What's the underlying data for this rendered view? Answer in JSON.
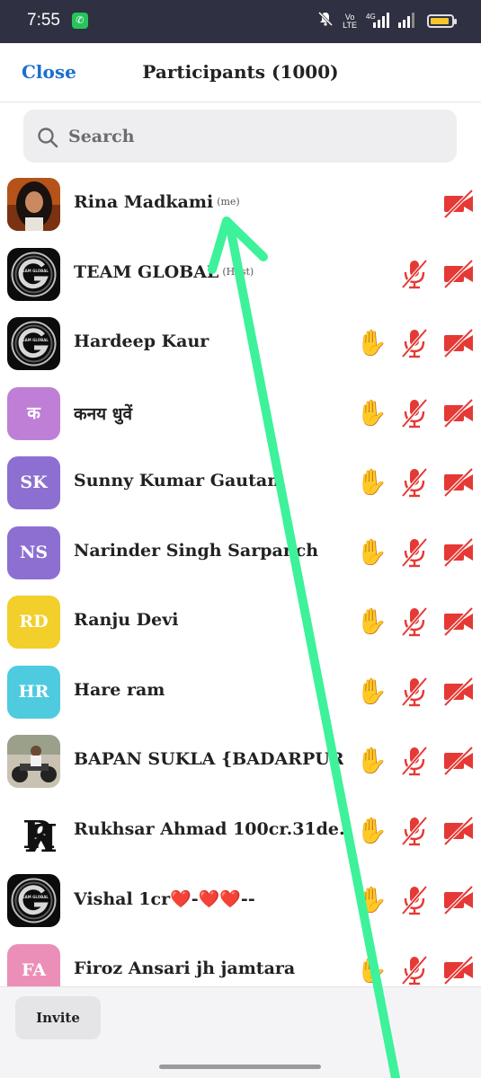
{
  "status_bar": {
    "time": "7:55",
    "app_icon": "whatsapp-icon",
    "icons": [
      "mute-icon",
      "volte-icon",
      "signal-icon",
      "battery-icon"
    ],
    "volte_label": "Vo\nLTE",
    "network_label": "4G"
  },
  "header": {
    "close_label": "Close",
    "title": "Participants (1000)"
  },
  "search": {
    "placeholder": "Search"
  },
  "participants": [
    {
      "name": "Rina Madkami",
      "suffix": "(me)",
      "avatar": "photo-woman",
      "hand_raised": false,
      "mic": "none",
      "camera": "off"
    },
    {
      "name": "TEAM GLOBAL",
      "suffix": "(Host)",
      "avatar": "logo-team-global",
      "hand_raised": false,
      "mic": "muted",
      "camera": "off"
    },
    {
      "name": "Hardeep Kaur",
      "suffix": "",
      "avatar": "logo-team-global",
      "hand_raised": true,
      "mic": "muted",
      "camera": "off"
    },
    {
      "name": "कनय धुवें",
      "suffix": "",
      "avatar_text": "क",
      "avatar_color": "#c07fd6",
      "hand_raised": true,
      "mic": "muted",
      "camera": "off"
    },
    {
      "name": "Sunny Kumar Gautam",
      "suffix": "",
      "avatar_text": "SK",
      "avatar_color": "#8c6fd1",
      "hand_raised": true,
      "mic": "muted",
      "camera": "off"
    },
    {
      "name": "Narinder Singh Sarpanch",
      "suffix": "",
      "avatar_text": "NS",
      "avatar_color": "#8c6fd1",
      "hand_raised": true,
      "mic": "muted",
      "camera": "off"
    },
    {
      "name": "Ranju Devi",
      "suffix": "",
      "avatar_text": "RD",
      "avatar_color": "#f2cf2a",
      "hand_raised": true,
      "mic": "muted",
      "camera": "off"
    },
    {
      "name": "Hare ram",
      "suffix": "",
      "avatar_text": "HR",
      "avatar_color": "#4fcbe0",
      "hand_raised": true,
      "mic": "muted",
      "camera": "off"
    },
    {
      "name": "BAPAN SUKLA {BADARPUR}",
      "suffix": "",
      "avatar": "photo-motorbike",
      "hand_raised": true,
      "mic": "muted",
      "camera": "off"
    },
    {
      "name": "Rukhsar Ahmad 100cr.31de...",
      "suffix": "",
      "avatar": "logo-rr",
      "hand_raised": true,
      "mic": "muted",
      "camera": "off"
    },
    {
      "name": "Vishal 1cr❤️-❤️❤️--",
      "suffix": "",
      "avatar": "logo-team-global",
      "hand_raised": true,
      "mic": "muted",
      "camera": "off"
    },
    {
      "name": "Firoz Ansari jh jamtara",
      "suffix": "",
      "avatar_text": "FA",
      "avatar_color": "#ec8fb8",
      "hand_raised": true,
      "mic": "muted",
      "camera": "off"
    }
  ],
  "footer": {
    "invite_label": "Invite"
  },
  "colors": {
    "accent": "#1e6fce",
    "muted_red": "#e53935",
    "hand_yellow": "#f5b700",
    "annotation_green": "#3df29a"
  }
}
